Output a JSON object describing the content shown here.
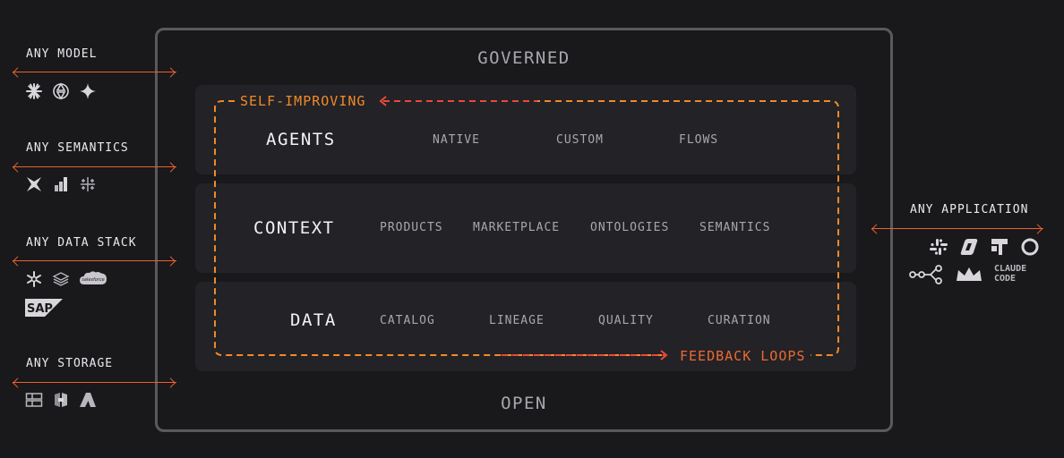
{
  "frame": {
    "top_label": "GOVERNED",
    "bottom_label": "OPEN"
  },
  "loop": {
    "top_label": "SELF-IMPROVING",
    "bottom_label": "FEEDBACK LOOPS",
    "color_orange": "#f08a2a",
    "color_red": "#e8493a"
  },
  "left": [
    {
      "label": "ANY MODEL",
      "icons": [
        "claude-starburst-icon",
        "openai-knot-icon",
        "gemini-sparkle-icon"
      ]
    },
    {
      "label": "ANY SEMANTICS",
      "icons": [
        "dbt-icon",
        "bar-steps-icon",
        "tableau-cross-icon"
      ]
    },
    {
      "label": "ANY DATA STACK",
      "icons": [
        "snowflake-icon",
        "layers-stack-icon",
        "salesforce-cloud-icon",
        "sap-icon"
      ],
      "sap_text": "SAP",
      "salesforce_text": "salesforce"
    },
    {
      "label": "ANY STORAGE",
      "icons": [
        "server-grid-icon",
        "s3-bucket-icon",
        "azure-a-icon"
      ]
    }
  ],
  "right": {
    "label": "ANY APPLICATION",
    "icons": [
      "slack-icon",
      "copilot-icon",
      "jira-icon",
      "chat-ring-icon",
      "flow-nodes-icon",
      "crown-icon",
      "claude-code-icon"
    ],
    "claude_code_text": [
      "CLAUDE",
      "CODE"
    ]
  },
  "bands": [
    {
      "title": "AGENTS",
      "items": [
        "NATIVE",
        "CUSTOM",
        "FLOWS"
      ]
    },
    {
      "title": "CONTEXT",
      "items": [
        "PRODUCTS",
        "MARKETPLACE",
        "ONTOLOGIES",
        "SEMANTICS"
      ]
    },
    {
      "title": "DATA",
      "items": [
        "CATALOG",
        "LINEAGE",
        "QUALITY",
        "CURATION"
      ]
    }
  ]
}
